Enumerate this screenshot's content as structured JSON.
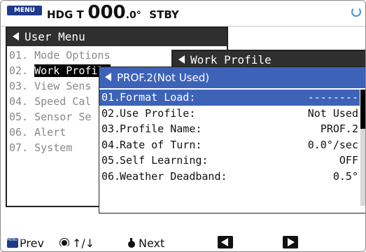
{
  "status": {
    "menu_key": "MENU",
    "heading_label": "HDG T",
    "heading_int": "000",
    "heading_dec": ".0°",
    "mode": "STBY"
  },
  "user_menu": {
    "title": "User Menu",
    "items": [
      {
        "num": "01.",
        "label": "Mode Options"
      },
      {
        "num": "02.",
        "label": "Work Profile"
      },
      {
        "num": "03.",
        "label": "View Sens"
      },
      {
        "num": "04.",
        "label": "Speed Cal"
      },
      {
        "num": "05.",
        "label": "Sensor Se"
      },
      {
        "num": "06.",
        "label": "Alert"
      },
      {
        "num": "07.",
        "label": "System"
      }
    ]
  },
  "work_profile": {
    "title": "Work Profile"
  },
  "prof2": {
    "title": "PROF.2(Not Used)",
    "rows": [
      {
        "num": "01.",
        "label": "Format Load:",
        "value": "--------"
      },
      {
        "num": "02.",
        "label": "Use Profile:",
        "value": "Not Used"
      },
      {
        "num": "03.",
        "label": "Profile Name:",
        "value": "PROF.2"
      },
      {
        "num": "04.",
        "label": "Rate of Turn:",
        "value": "0.0°/sec"
      },
      {
        "num": "05.",
        "label": "Self Learning:",
        "value": "OFF"
      },
      {
        "num": "06.",
        "label": "Weather Deadband:",
        "value": "0.5°"
      }
    ]
  },
  "bottom": {
    "prev_key": "MENU ESC",
    "prev": "Prev",
    "scroll": "↑/↓",
    "next": "Next"
  },
  "colors": {
    "title_bar": "#2f2f2f",
    "selection": "#3d63b8",
    "menu_key": "#1f3a8a"
  }
}
